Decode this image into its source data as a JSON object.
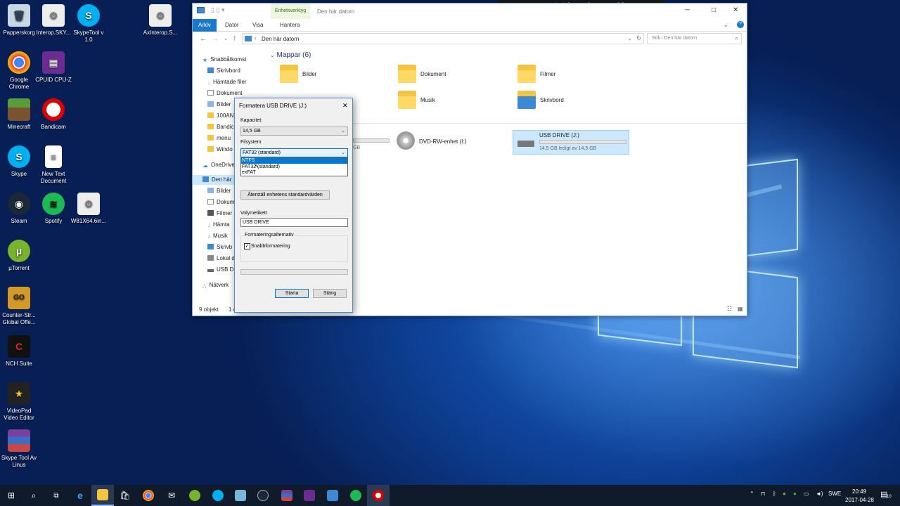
{
  "desktop": {
    "icons": [
      {
        "label": "Papperskorg"
      },
      {
        "label": "Interop.SKY..."
      },
      {
        "label": "SkypeTool v 1.0"
      },
      {
        "label": "AxInterop.S..."
      },
      {
        "label": "Google Chrome"
      },
      {
        "label": "CPUID CPU-Z"
      },
      {
        "label": "Minecraft"
      },
      {
        "label": "Bandicam"
      },
      {
        "label": "Skype"
      },
      {
        "label": "New Text Document"
      },
      {
        "label": "Steam"
      },
      {
        "label": "Spotify"
      },
      {
        "label": "W81X64.6in..."
      },
      {
        "label": "µTorrent"
      },
      {
        "label": "Counter-Str... Global Offe..."
      },
      {
        "label": "NCH Suite"
      },
      {
        "label": "VideoPad Video Editor"
      },
      {
        "label": "Skype Tool Av Linus"
      }
    ]
  },
  "recorder": {
    "status": "Spelar in [00:00:18]"
  },
  "explorer": {
    "title": "Den här datorn",
    "context_tab": "Enhetsverktyg",
    "tabs": [
      "Arkiv",
      "Dator",
      "Visa",
      "Hantera"
    ],
    "address": "Den här datorn",
    "search_placeholder": "Sök i Den här datorn",
    "section_title": "Mappar (6)",
    "nav": {
      "quick_access": "Snabbåtkomst",
      "items": [
        "Skrivbord",
        "Hämtade filer",
        "Dokument",
        "Bilder",
        "100AN",
        "Bandic",
        "menu",
        "Windo"
      ],
      "onedrive": "OneDrive",
      "this_pc": "Den här",
      "pc_items": [
        "Bilder",
        "Dokum",
        "Filmer",
        "Hämta",
        "Musik",
        "Skrivb",
        "Lokal d",
        "USB DR"
      ],
      "network": "Nätverk"
    },
    "folders": [
      "Bilder",
      "Dokument",
      "Filmer",
      "Musik",
      "Skrivbord"
    ],
    "drives": [
      {
        "name": "DVD-RW-enhet (I:)"
      },
      {
        "name": "USB DRIVE (J:)",
        "free": "14,5 GB ledigt av 14,5 GB"
      }
    ],
    "partial_drive_text": "GB",
    "status_count": "9 objekt",
    "status_selected": "1 obj"
  },
  "format_dialog": {
    "title": "Formatera USB DRIVE (J:)",
    "capacity_label": "Kapacitet:",
    "capacity_value": "14,5 GB",
    "fs_label": "Filsystem",
    "fs_value": "FAT32 (standard)",
    "fs_options": [
      "NTFS",
      "FAT32 (standard)",
      "exFAT"
    ],
    "restore_button": "Återställ enhetens standardvärden",
    "volume_label": "Volymetikett",
    "volume_value": "USB DRIVE",
    "options_group": "Formateringsalternativ",
    "quick_format": "Snabbformatering",
    "start_button": "Starta",
    "close_button": "Stäng"
  },
  "taskbar": {
    "lang": "SWE",
    "time": "20:49",
    "date": "2017-04-28",
    "notif_count": "10"
  }
}
